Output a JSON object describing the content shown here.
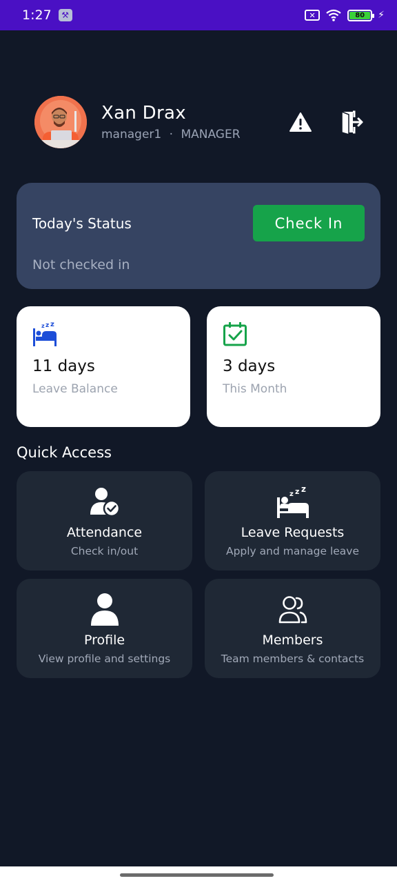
{
  "status_bar": {
    "time": "1:27",
    "battery": "80"
  },
  "header": {
    "name": "Xan Drax",
    "username": "manager1",
    "separator": "·",
    "role": "MANAGER"
  },
  "today_status": {
    "title": "Today's Status",
    "value": "Not checked in",
    "button_label": "Check In"
  },
  "stats": [
    {
      "value": "11 days",
      "label": "Leave Balance",
      "icon": "bed-icon"
    },
    {
      "value": "3 days",
      "label": "This Month",
      "icon": "calendar-check-icon"
    }
  ],
  "quick_access": {
    "title": "Quick Access",
    "items": [
      {
        "title": "Attendance",
        "subtitle": "Check in/out",
        "icon": "user-check-icon"
      },
      {
        "title": "Leave Requests",
        "subtitle": "Apply and manage leave",
        "icon": "sleep-bed-icon"
      },
      {
        "title": "Profile",
        "subtitle": "View profile and settings",
        "icon": "person-icon"
      },
      {
        "title": "Members",
        "subtitle": "Team members & contacts",
        "icon": "users-icon"
      }
    ]
  },
  "colors": {
    "background": "#111827",
    "status_bar": "#4a10c4",
    "status_card": "#364462",
    "check_in_button": "#16a34a",
    "tile": "#1f2835",
    "bed_icon": "#1d4ed8",
    "calendar_icon": "#16a34a"
  }
}
